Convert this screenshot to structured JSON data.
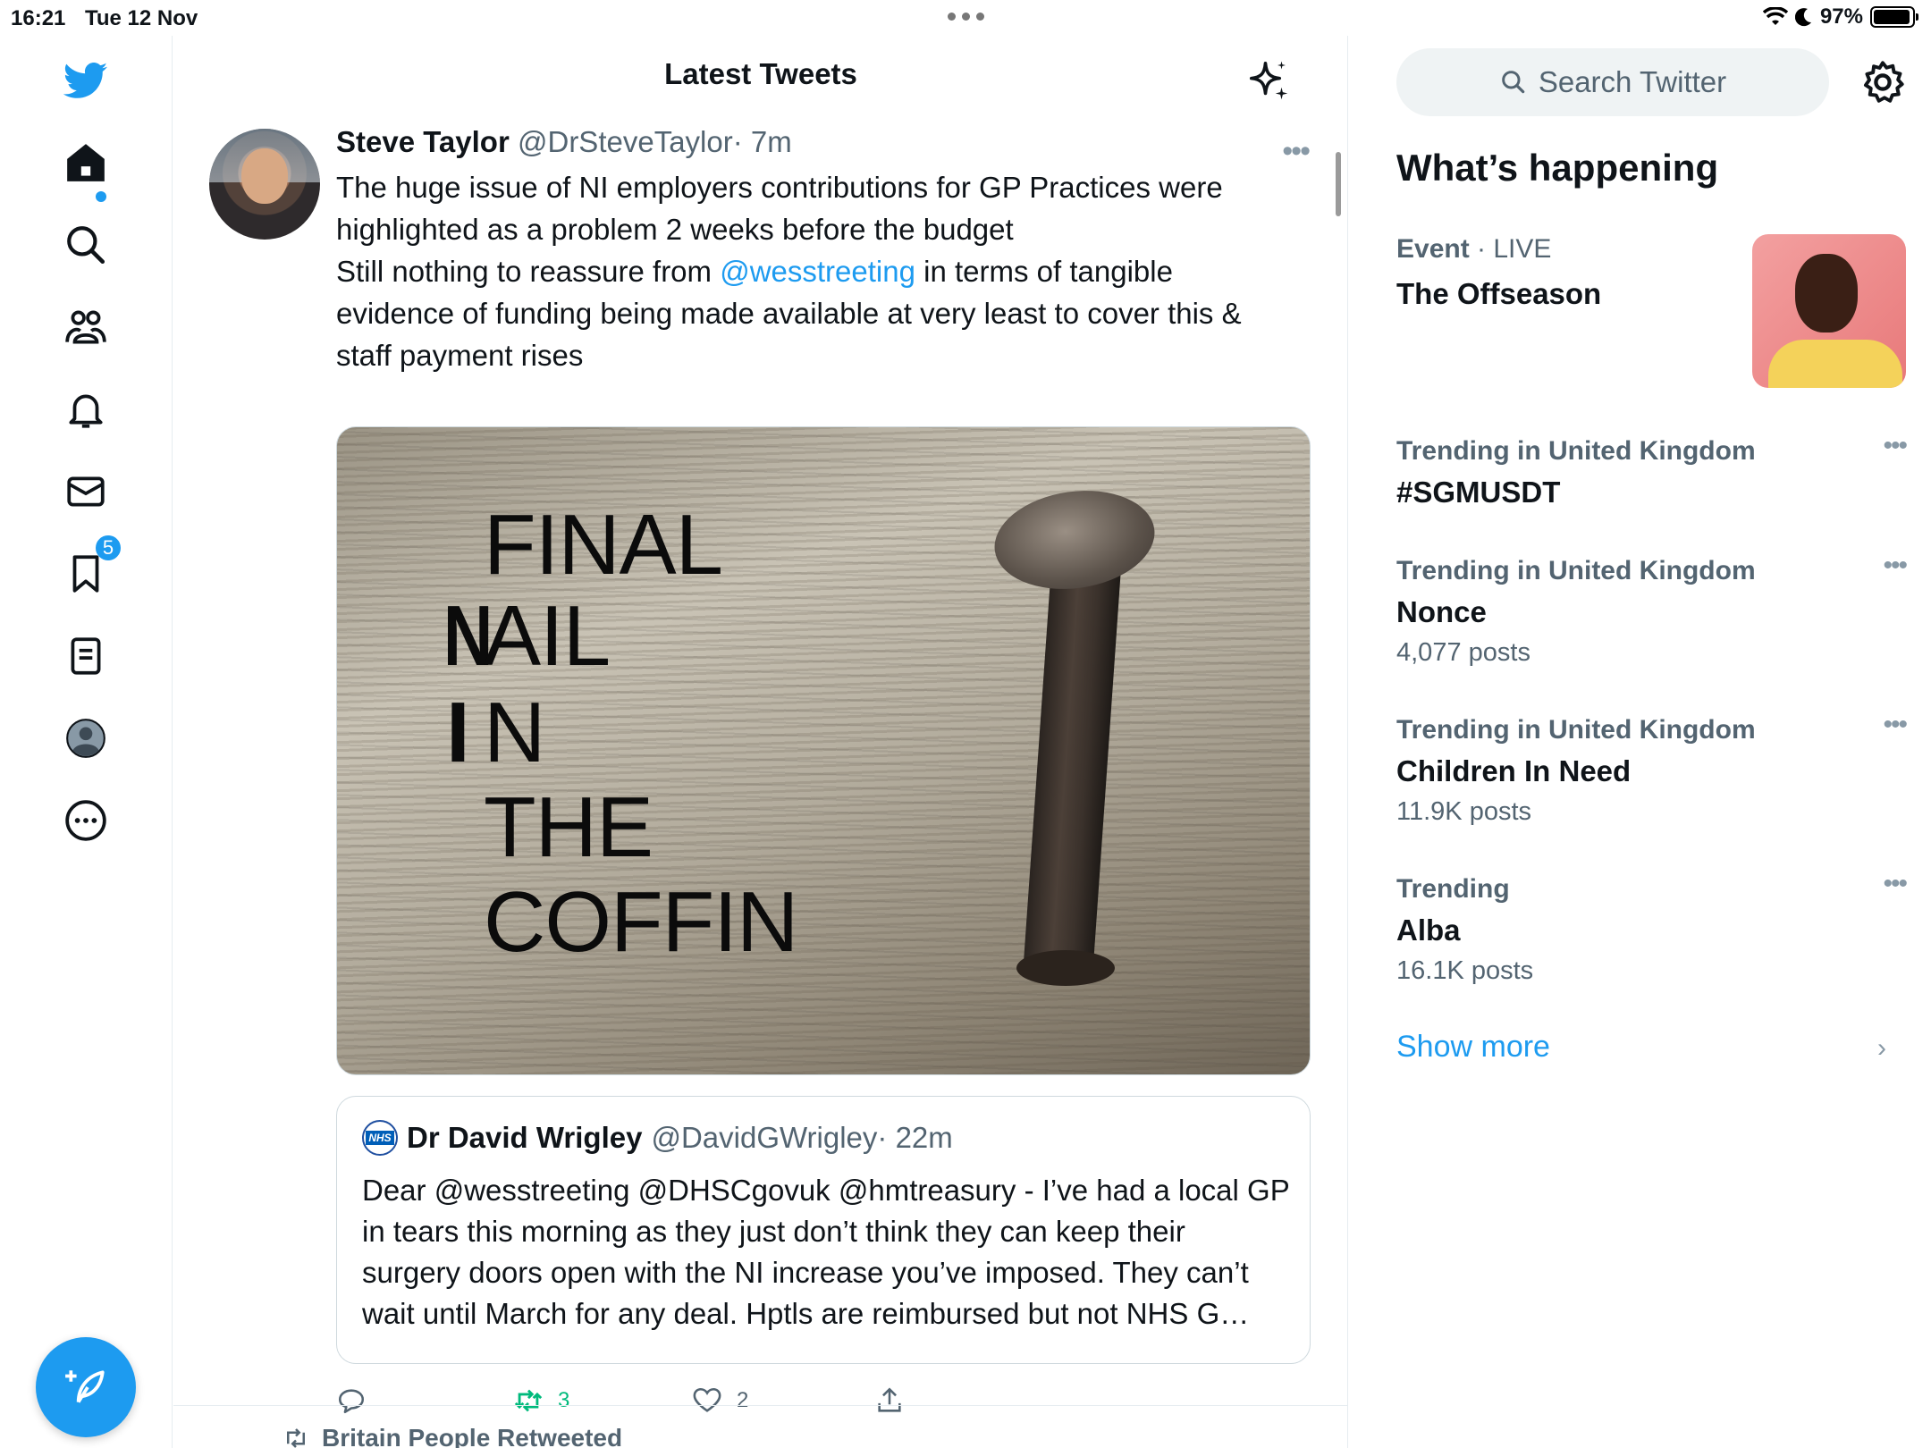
{
  "status_bar": {
    "time": "16:21",
    "date": "Tue 12 Nov",
    "battery": "97%"
  },
  "nav": {
    "notifications_badge": "5"
  },
  "main": {
    "title": "Latest Tweets",
    "tweet": {
      "name": "Steve Taylor",
      "handle": "@DrSteveTaylor",
      "time": "· 7m",
      "text_1": "The huge issue of NI employers contributions for GP Practices were highlighted as a problem 2 weeks before the budget",
      "text_2_pre": "Still nothing to reassure from ",
      "text_2_mention": "@wesstreeting",
      "text_2_post": " in terms of tangible evidence of funding being made available at very least to cover this & staff payment rises",
      "image_lines": [
        "FINAL",
        "N",
        "AIL",
        "I",
        "N",
        "THE",
        "COFFIN"
      ],
      "quote": {
        "avatar_label": "NHS",
        "name": "Dr David Wrigley",
        "handle": "@DavidGWrigley",
        "time": "· 22m",
        "text": "Dear @wesstreeting @DHSCgovuk @hmtreasury - I’ve had a local GP in tears this morning as they just don’t think they can keep their surgery doors open with the NI increase you’ve imposed. They can’t wait until March for any deal. Hptls are reimbursed but not NHS G…"
      },
      "retweets": "3",
      "likes": "2"
    },
    "next_retweeted_by": "Britain People Retweeted"
  },
  "sidebar": {
    "search_placeholder": "Search Twitter",
    "whats_happening": "What’s happening",
    "event": {
      "category": "Event",
      "status": "· LIVE",
      "title": "The Offseason"
    },
    "trends": [
      {
        "category": "Trending in United Kingdom",
        "name": "#SGMUSDT",
        "count": ""
      },
      {
        "category": "Trending in United Kingdom",
        "name": "Nonce",
        "count": "4,077 posts"
      },
      {
        "category": "Trending in United Kingdom",
        "name": "Children In Need",
        "count": "11.9K posts"
      },
      {
        "category": "Trending",
        "name": "Alba",
        "count": "16.1K posts"
      }
    ],
    "show_more": "Show more"
  },
  "colors": {
    "accent": "#1d9bf0",
    "retweet": "#00ba7c",
    "muted": "#536471"
  }
}
